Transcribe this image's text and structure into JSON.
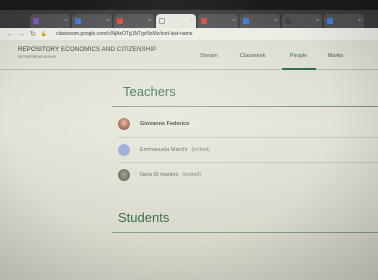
{
  "browser": {
    "tabs": [
      {
        "label": "",
        "fav_color": "#7b58b6"
      },
      {
        "label": "",
        "fav_color": "#3f79d6"
      },
      {
        "label": "",
        "fav_color": "#d04a3e"
      },
      {
        "label": "",
        "fav_color": "#e7e7e7"
      },
      {
        "label": "",
        "fav_color": "#d04a3e"
      },
      {
        "label": "",
        "fav_color": "#3f79d6"
      },
      {
        "label": "",
        "fav_color": "#444444"
      },
      {
        "label": "",
        "fav_color": "#3f79d6"
      }
    ],
    "url": "classroom.google.com/c/NjAxOTg1NTgxNzMz/sort-last-name"
  },
  "classroom": {
    "title": "REPOSITORY ECONOMICS AND CITIZENSHIP",
    "section": "ENTREPRENEURSHIP",
    "nav": {
      "stream": "Stream",
      "classwork": "Classwork",
      "people": "People",
      "marks": "Marks"
    }
  },
  "teachers": {
    "heading": "Teachers",
    "list": [
      {
        "name": "Giovanne Federico",
        "status": "",
        "avatar": "photo"
      },
      {
        "name": "Emmanuela Marchi",
        "status": "(invited)",
        "avatar": "default"
      },
      {
        "name": "Ilaria Di martino",
        "status": "(invited)",
        "avatar": "photo"
      }
    ]
  },
  "students": {
    "heading": "Students"
  },
  "colors": {
    "accent": "#2e6a45",
    "default_avatar": "#8fa3d9"
  }
}
